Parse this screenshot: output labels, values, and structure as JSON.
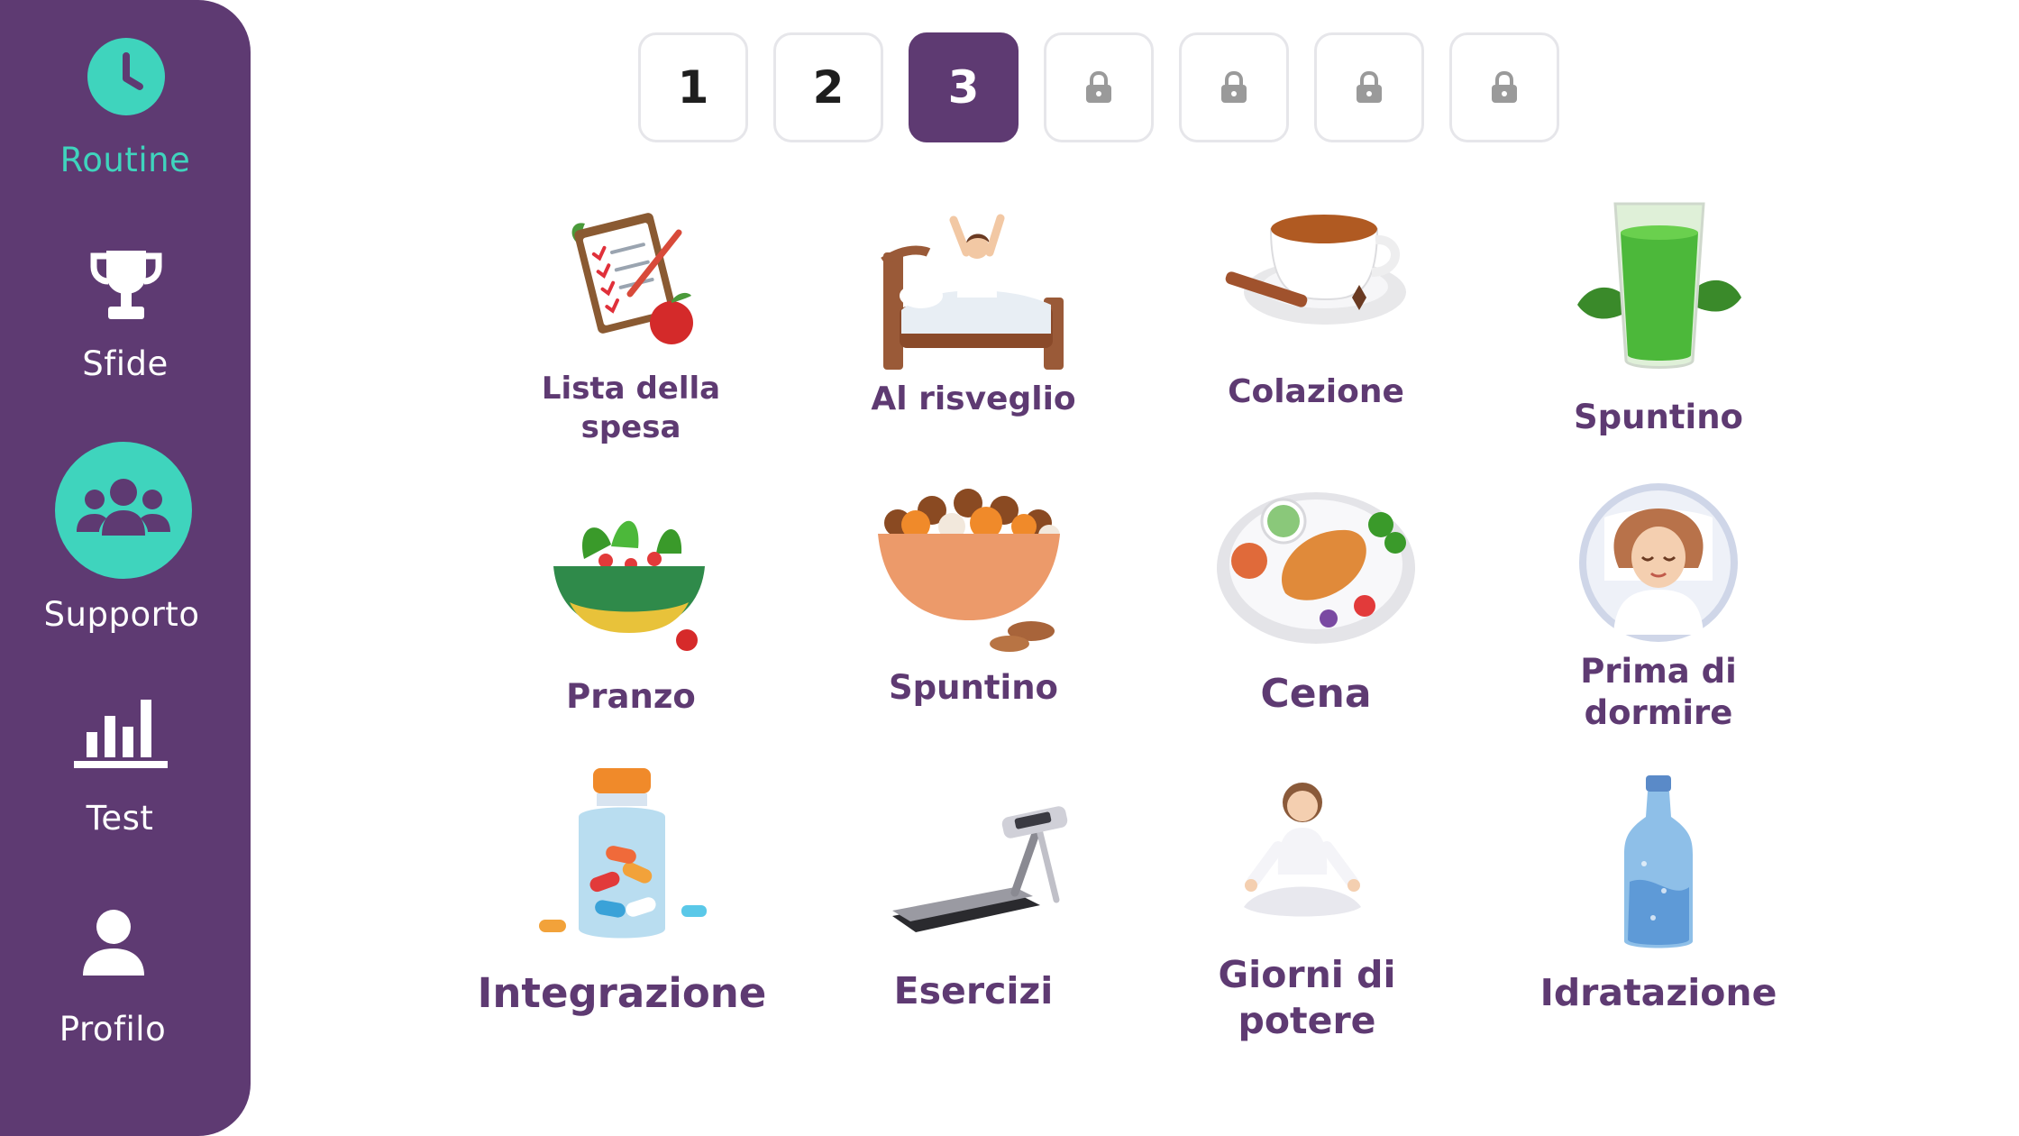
{
  "sidebar": {
    "items": [
      {
        "label": "Routine",
        "icon": "clock-icon",
        "active": true
      },
      {
        "label": "Sfide",
        "icon": "trophy-icon"
      },
      {
        "label": "Supporto",
        "icon": "group-icon"
      },
      {
        "label": "Test",
        "icon": "bar-chart-icon"
      },
      {
        "label": "Profilo",
        "icon": "user-icon"
      }
    ]
  },
  "pager": {
    "pages": [
      "1",
      "2",
      "3"
    ],
    "active_page": "3",
    "locked_count": 4
  },
  "tiles": [
    {
      "label": "Lista della spesa",
      "icon": "shopping-list-icon"
    },
    {
      "label": "Al risveglio",
      "icon": "wake-up-icon"
    },
    {
      "label": "Colazione",
      "icon": "breakfast-icon"
    },
    {
      "label": "Spuntino",
      "icon": "green-juice-icon"
    },
    {
      "label": "Pranzo",
      "icon": "salad-bowl-icon"
    },
    {
      "label": "Spuntino",
      "icon": "nuts-bowl-icon"
    },
    {
      "label": "Cena",
      "icon": "dinner-plate-icon"
    },
    {
      "label": "Prima di dormire",
      "icon": "sleeping-woman-icon"
    },
    {
      "label": "Integrazione",
      "icon": "supplements-bottle-icon"
    },
    {
      "label": "Esercizi",
      "icon": "treadmill-icon"
    },
    {
      "label": "Giorni di potere",
      "icon": "meditation-icon"
    },
    {
      "label": "Idratazione",
      "icon": "water-bottle-icon"
    }
  ],
  "colors": {
    "primary": "#5e3a72",
    "accent": "#3fd4bd",
    "label": "#5e3a72"
  }
}
